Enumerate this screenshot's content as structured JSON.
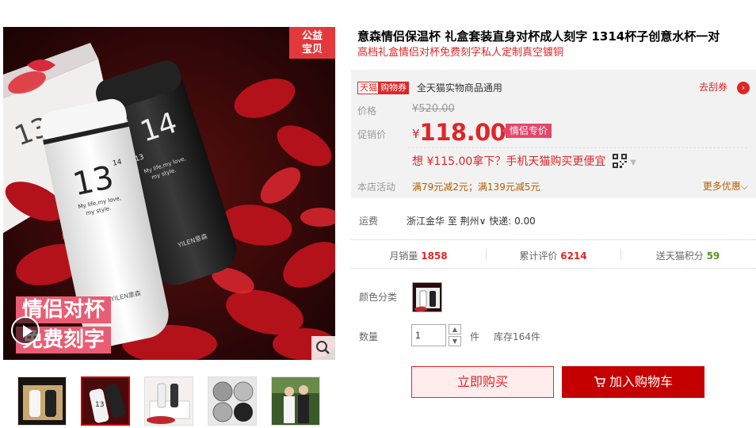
{
  "gallery": {
    "charity_badge": [
      "公益",
      "宝贝"
    ],
    "promo_lines": [
      "情侣对杯",
      "免费刻字"
    ],
    "bottle_white_number": "13",
    "bottle_white_sup": "14",
    "bottle_black_number": "14",
    "bottle_black_sup": "13",
    "bottle_text_white": "My life,my love, my style.",
    "bottle_text_black": "My life,my love, my style.",
    "bottle_brand": "YILEN意森",
    "thumbs": [
      {
        "icon": "product-thumb-gift-box"
      },
      {
        "icon": "product-thumb-bottles"
      },
      {
        "icon": "product-thumb-packaging"
      },
      {
        "icon": "product-thumb-lids"
      },
      {
        "icon": "product-thumb-couple"
      }
    ]
  },
  "product": {
    "title": "意森情侣保温杯 礼盒套装直身对杯成人刻字 1314杯子创意水杯一对",
    "subtitle": "高档礼盒情侣对杯免费刻字私人定制真空镀铜"
  },
  "pricebox": {
    "tmall_tag": "天猫",
    "coupon_tag": "购物券",
    "coupon_text": "全天猫实物商品通用",
    "coupon_link": "去刮券",
    "price_label": "价格",
    "orig_price": "¥520.00",
    "promo_label": "促销价",
    "promo_currency": "¥",
    "promo_price": "118.00",
    "promo_badge": "情侣专价",
    "mobile_text": "想 ¥115.00拿下？手机天猫购买更便宜",
    "activity_label": "本店活动",
    "activity_1": "满79元减2元",
    "activity_sep": "；",
    "activity_2": "满139元减5元",
    "more_promo": "更多优惠"
  },
  "shipping": {
    "label": "运费",
    "value": "浙江金华  至  荆州∨  快递: 0.00"
  },
  "stats": {
    "monthly_label": "月销量",
    "monthly_value": "1858",
    "reviews_label": "累计评价",
    "reviews_value": "6214",
    "points_label": "送天猫积分",
    "points_value": "59"
  },
  "sku": {
    "color_label": "颜色分类",
    "qty_label": "数量",
    "qty_value": "1",
    "unit": "件",
    "stock": "库存164件"
  },
  "actions": {
    "buy_now": "立即购买",
    "add_cart": "加入购物车"
  },
  "colors": {
    "accent": "#dd2727",
    "cart_bg": "#c40000",
    "price_badge": "#e4476b",
    "points_green": "#4d9b1b"
  }
}
